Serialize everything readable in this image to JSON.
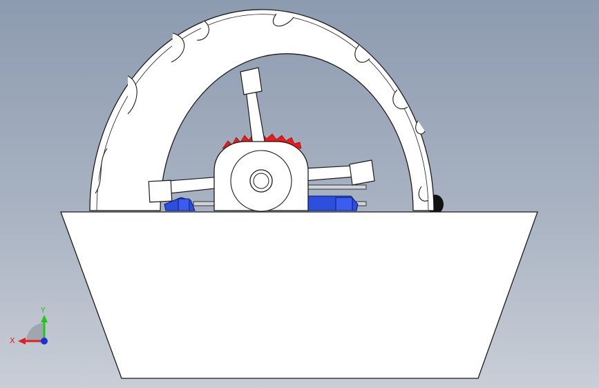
{
  "viewport": {
    "background_top": "#8d9bb0",
    "background_bottom": "#c9ced7"
  },
  "model": {
    "tire_color": "#ffffff",
    "outline_color": "#1a1a1a",
    "gear_color": "#e81a1a",
    "motor_color": "#2c4fe0",
    "base_color": "#ffffff"
  },
  "triad": {
    "x_label": "X",
    "y_label": "Y",
    "x_color": "#e0201a",
    "y_color": "#22c51a",
    "z_color": "#1a2ee0"
  }
}
